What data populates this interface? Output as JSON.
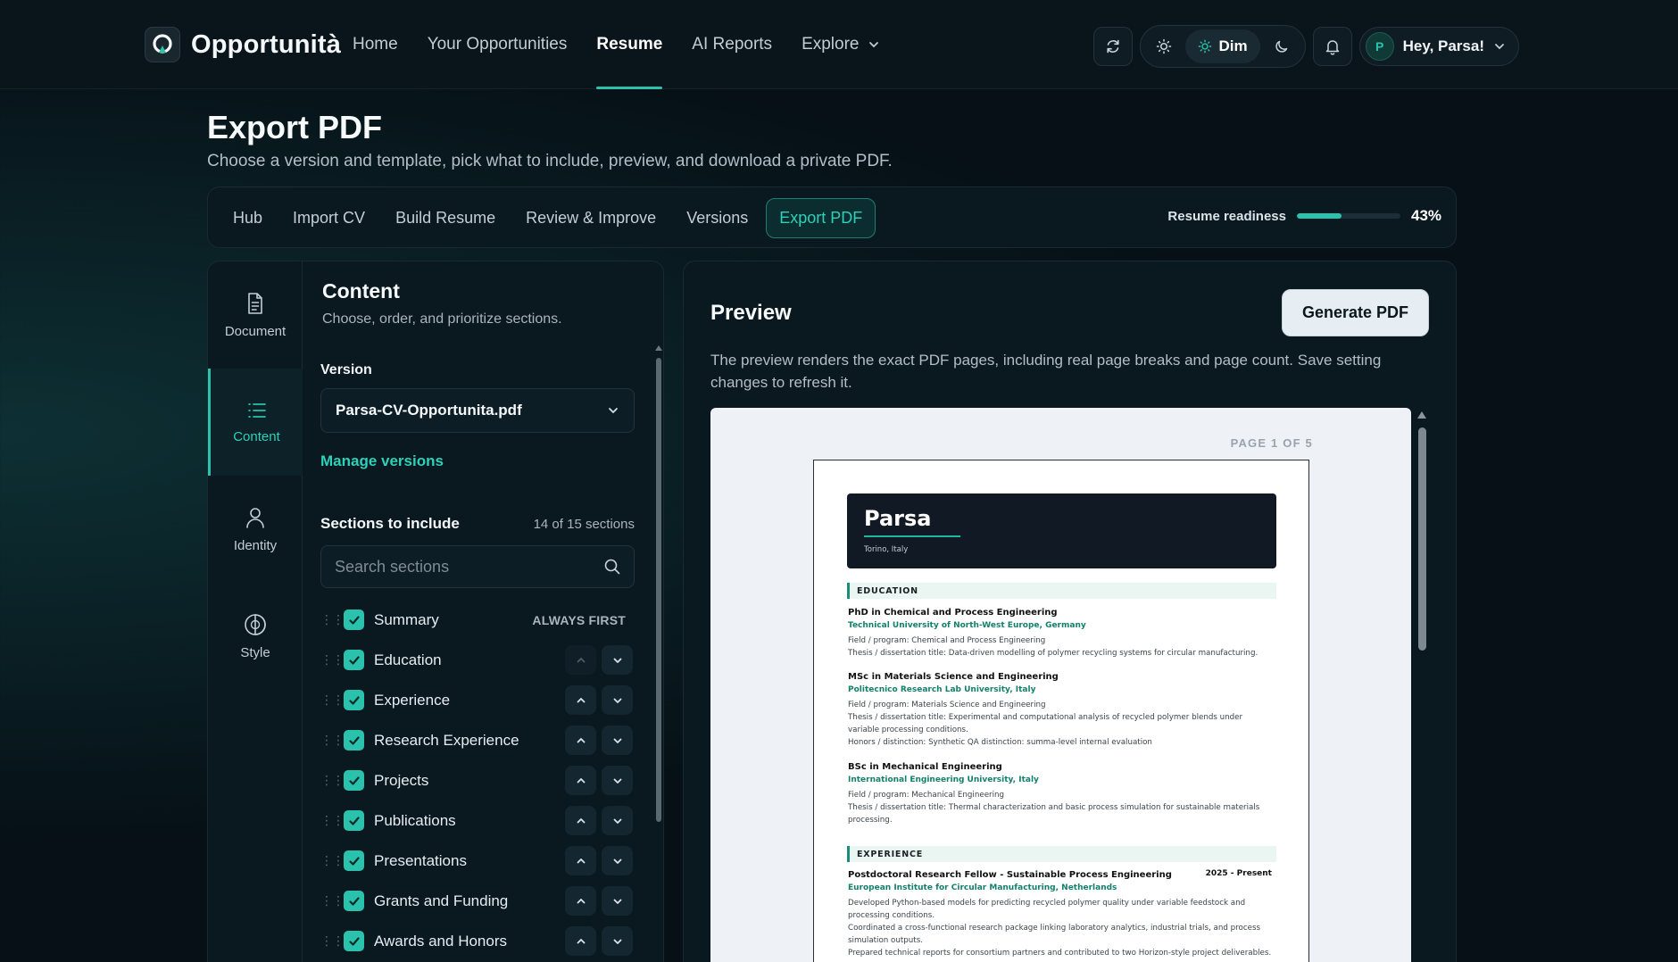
{
  "brand": {
    "name": "Opportunità",
    "logo_icon": "brand-logo-icon"
  },
  "nav": {
    "links": [
      {
        "label": "Home"
      },
      {
        "label": "Your Opportunities"
      },
      {
        "label": "Resume",
        "active": true
      },
      {
        "label": "AI Reports"
      },
      {
        "label": "Explore",
        "has_dropdown": true
      }
    ],
    "theme": {
      "active_label": "Dim",
      "options": [
        "light",
        "dim",
        "dark"
      ]
    },
    "user": {
      "initial": "P",
      "greeting": "Hey, Parsa!"
    }
  },
  "page": {
    "title": "Export PDF",
    "subtitle": "Choose a version and template, pick what to include, preview, and download a private PDF."
  },
  "steps": {
    "items": [
      {
        "label": "Hub"
      },
      {
        "label": "Import CV"
      },
      {
        "label": "Build Resume"
      },
      {
        "label": "Review & Improve"
      },
      {
        "label": "Versions"
      },
      {
        "label": "Export PDF",
        "active": true
      }
    ],
    "readiness_label": "Resume readiness",
    "readiness_percent": 43,
    "readiness_text": "43%",
    "accent_color": "#2ac2ac"
  },
  "rail": {
    "items": [
      {
        "label": "Document",
        "icon": "document-icon"
      },
      {
        "label": "Content",
        "icon": "list-icon",
        "active": true
      },
      {
        "label": "Identity",
        "icon": "person-icon"
      },
      {
        "label": "Style",
        "icon": "contrast-icon"
      }
    ]
  },
  "content": {
    "title": "Content",
    "subtitle": "Choose, order, and prioritize sections.",
    "version_label": "Version",
    "version_value": "Parsa-CV-Opportunita.pdf",
    "manage_link": "Manage versions",
    "sections_label": "Sections to include",
    "sections_count": "14 of 15 sections",
    "search_placeholder": "Search sections",
    "always_first": "ALWAYS FIRST",
    "sections": [
      {
        "label": "Summary",
        "checked": true
      },
      {
        "label": "Education",
        "checked": true
      },
      {
        "label": "Experience",
        "checked": true
      },
      {
        "label": "Research Experience",
        "checked": true
      },
      {
        "label": "Projects",
        "checked": true
      },
      {
        "label": "Publications",
        "checked": true
      },
      {
        "label": "Presentations",
        "checked": true
      },
      {
        "label": "Grants and Funding",
        "checked": true
      },
      {
        "label": "Awards and Honors",
        "checked": true
      }
    ]
  },
  "preview": {
    "title": "Preview",
    "generate_label": "Generate PDF",
    "description": "The preview renders the exact PDF pages, including real page breaks and page count. Save setting changes to refresh it.",
    "page_counter": "PAGE 1 OF 5",
    "cv": {
      "name": "Parsa",
      "location": "Torino, Italy",
      "education_head": "EDUCATION",
      "education": [
        {
          "title": "PhD in Chemical and Process Engineering",
          "institution": "Technical University of North-West Europe, Germany",
          "lines": [
            "Field / program: Chemical and Process Engineering",
            "Thesis / dissertation title: Data-driven modelling of polymer recycling systems for circular manufacturing."
          ]
        },
        {
          "title": "MSc in Materials Science and Engineering",
          "institution": "Politecnico Research Lab University, Italy",
          "lines": [
            "Field / program: Materials Science and Engineering",
            "Thesis / dissertation title: Experimental and computational analysis of recycled polymer blends under variable processing conditions.",
            "Honors / distinction: Synthetic QA distinction: summa-level internal evaluation"
          ]
        },
        {
          "title": "BSc in Mechanical Engineering",
          "institution": "International Engineering University, Italy",
          "lines": [
            "Field / program: Mechanical Engineering",
            "Thesis / dissertation title: Thermal characterization and basic process simulation for sustainable materials processing."
          ]
        }
      ],
      "experience_head": "EXPERIENCE",
      "experience": [
        {
          "title": "Postdoctoral Research Fellow - Sustainable Process Engineering",
          "date": "2025 - Present",
          "institution": "European Institute for Circular Manufacturing, Netherlands",
          "lines": [
            "Developed Python-based models for predicting recycled polymer quality under variable feedstock and processing conditions.",
            "Coordinated a cross-functional research package linking laboratory analytics, industrial trials, and process simulation outputs.",
            "Prepared technical reports for consortium partners and contributed to two Horizon-style project deliverables."
          ]
        }
      ]
    }
  }
}
